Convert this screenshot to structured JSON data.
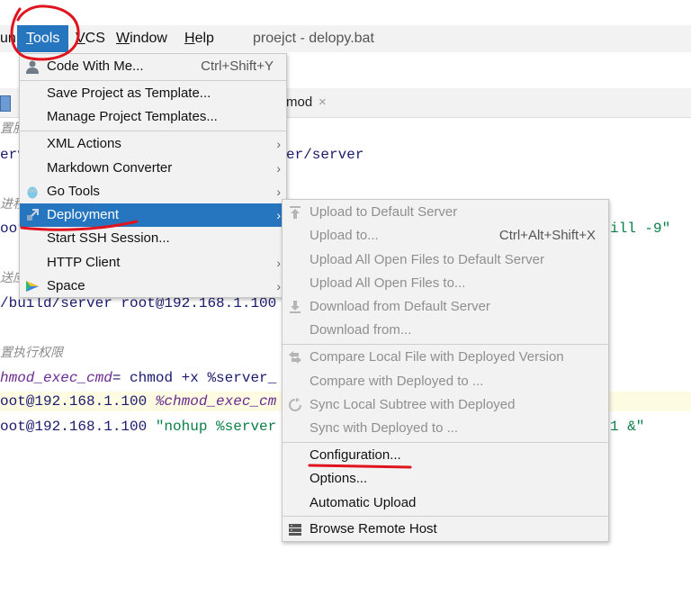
{
  "menubar": {
    "items": [
      {
        "label": "un"
      },
      {
        "label": "Tools",
        "mnemonic": "T",
        "rest": "ools"
      },
      {
        "label": "VCS",
        "mnemonic": "V",
        "rest": "CS"
      },
      {
        "label": "Window",
        "mnemonic": "W",
        "rest": "indow"
      },
      {
        "label": "Help",
        "mnemonic": "H",
        "rest": "elp"
      }
    ],
    "title": "proejct - delopy.bat"
  },
  "editor": {
    "tab_label": "mod",
    "tab_close": "×",
    "lines": [
      {
        "text": "置服"
      },
      {
        "text": "erv",
        "tail": "er/server"
      },
      {
        "text": "进程"
      },
      {
        "text": "oot",
        "tail": "ill -9\""
      },
      {
        "text": "送应"
      },
      {
        "text": "/build/server root@192.168.1.100"
      },
      {
        "text": "置执行权限"
      },
      {
        "var": "hmod_exec_cmd",
        "rest": "= chmod +x %server_"
      },
      {
        "plain": "oot@192.168.1.100 ",
        "var": "%chmod_exec_cm"
      },
      {
        "plain": "oot@192.168.1.100 ",
        "str": "\"nohup %server",
        "tail": "1 &\""
      }
    ]
  },
  "tools_menu": {
    "items": [
      {
        "label": "Code With Me...",
        "shortcut": "Ctrl+Shift+Y",
        "icon": "user-icon"
      },
      {
        "label": "Save Project as Template..."
      },
      {
        "label": "Manage Project Templates..."
      },
      {
        "label": "XML Actions",
        "submenu": true
      },
      {
        "label": "Markdown Converter",
        "submenu": true
      },
      {
        "label": "Go Tools",
        "submenu": true,
        "icon": "gopher-icon"
      },
      {
        "label": "Deployment",
        "submenu": true,
        "icon": "deployment-icon",
        "selected": true
      },
      {
        "label": "Start SSH Session..."
      },
      {
        "label": "HTTP Client",
        "submenu": true
      },
      {
        "label": "Space",
        "submenu": true,
        "icon": "space-icon"
      }
    ],
    "arrow": "›"
  },
  "deployment_menu": {
    "items": [
      {
        "label": "Upload to Default Server",
        "disabled": true,
        "icon": "upload-icon"
      },
      {
        "label": "Upload to...",
        "shortcut": "Ctrl+Alt+Shift+X",
        "disabled": true
      },
      {
        "label": "Upload All Open Files to Default Server",
        "disabled": true
      },
      {
        "label": "Upload All Open Files to...",
        "disabled": true
      },
      {
        "label": "Download from Default Server",
        "disabled": true,
        "icon": "download-icon"
      },
      {
        "label": "Download from...",
        "disabled": true
      },
      {
        "label": "Compare Local File with Deployed Version",
        "disabled": true,
        "icon": "compare-icon"
      },
      {
        "label": "Compare with Deployed to ...",
        "disabled": true
      },
      {
        "label": "Sync Local Subtree with Deployed",
        "disabled": true,
        "icon": "sync-icon"
      },
      {
        "label": "Sync with Deployed to ...",
        "disabled": true
      },
      {
        "label": "Configuration..."
      },
      {
        "label": "Options..."
      },
      {
        "label": "Automatic Upload"
      },
      {
        "label": "Browse Remote Host",
        "icon": "remote-host-icon"
      }
    ]
  },
  "colors": {
    "menu_bg": "#f2f2f2",
    "selection": "#2675bf",
    "annotation_red": "#e0141e",
    "disabled_text": "#8f8f8f"
  }
}
